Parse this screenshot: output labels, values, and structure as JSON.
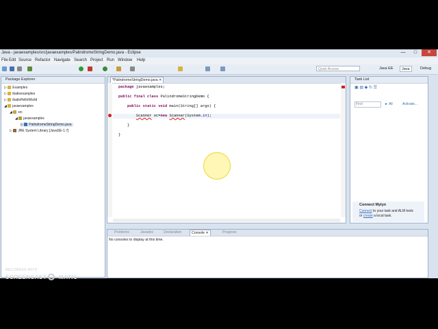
{
  "window": {
    "title": "Java - javaexamples/src/javaexamples/PalindromeStringDemo.java - Eclipse"
  },
  "menu": [
    "File",
    "Edit",
    "Source",
    "Refactor",
    "Navigate",
    "Search",
    "Project",
    "Run",
    "Window",
    "Help"
  ],
  "quick_access": {
    "placeholder": "Quick Access"
  },
  "perspectives": [
    "Java EE",
    "Java",
    "Debug"
  ],
  "package_explorer": {
    "title": "Package Explorer",
    "items": [
      {
        "label": "Examples"
      },
      {
        "label": "ibatisexamples"
      },
      {
        "label": "ibatisHelloWorld"
      },
      {
        "label": "javaexamples"
      },
      {
        "label": "src"
      },
      {
        "label": "javaexamples"
      },
      {
        "label": "PalindromeStringDemo.java"
      },
      {
        "label": "JRE System Library [JavaSE-1.7]"
      }
    ]
  },
  "editor": {
    "tab": "*PalindromeStringDemo.java",
    "lines": [
      "package javaexamples;",
      "",
      "public final class PalindromeStringDemo {",
      "",
      "    public static void main(String[] args) {",
      "",
      "        Scanner sc=new Scanner(System.in);",
      "",
      "    }",
      "",
      "}"
    ]
  },
  "task_list": {
    "title": "Task List",
    "find_placeholder": "Find",
    "all": "All",
    "activate": "Activate..."
  },
  "mylyn": {
    "title": "Connect Mylyn",
    "line1_link": "Connect",
    "line1_rest": " to your task and ALM tools",
    "line2_pre": "or ",
    "line2_link": "create",
    "line2_rest": " a local task."
  },
  "bottom_tabs": [
    "Problems",
    "Javadoc",
    "Declaration",
    "Console",
    "Progress"
  ],
  "console": {
    "message": "No consoles to display at this time."
  },
  "watermark": {
    "line1": "RECORDED WITH",
    "line2": "SCREENCAST",
    "line3": "MATIC"
  },
  "colors": {
    "accent": "#3a6fb0",
    "keyword": "#7f0055",
    "error": "#d02020"
  }
}
